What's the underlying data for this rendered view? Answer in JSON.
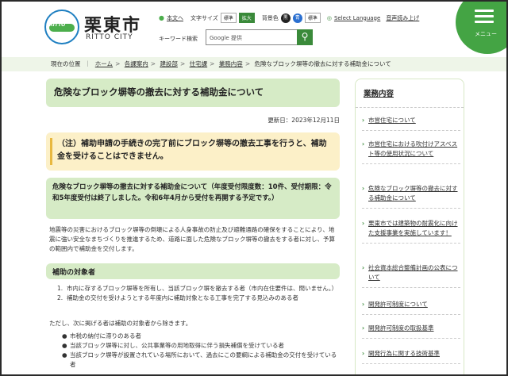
{
  "header": {
    "logo_text": "RITTO",
    "city_name": "栗東市",
    "city_en": "RITTO CITY",
    "about": "本文へ",
    "text_size_label": "文字サイズ",
    "size_standard": "標準",
    "size_large": "拡大",
    "bg_color_label": "背景色",
    "bg_black": "黒",
    "bg_blue": "青",
    "bg_standard": "標準",
    "language": "Select Language",
    "read_aloud": "音声読み上げ",
    "search_label": "キーワード検索",
    "search_placeholder": "Google 提供",
    "menu_label": "メニュー"
  },
  "breadcrumb": {
    "current_label": "現在の位置",
    "items": [
      "ホーム",
      "各課案内",
      "建設部",
      "住宅課",
      "業務内容"
    ],
    "current": "危険なブロック塀等の撤去に対する補助金について"
  },
  "main": {
    "title": "危険なブロック塀等の撤去に対する補助金について",
    "updated": "更新日：2023年12月11日",
    "notice": "（注）補助申請の手続きの完了前にブロック塀等の撤去工事を行うと、補助金を受けることはできません。",
    "subheading": "危険なブロック塀等の撤去に対する補助金について（年度受付限度数：10件、受付期限：令和5年度受付は終了しました。令和6年4月から受付を再開する予定です。）",
    "paragraph": "地震等の災害におけるブロック塀等の倒壊による人身事故の防止及び避難通路の確保をすることにより、地震に強い安全なまちづくりを推進するため、道路に面した危険なブロック塀等の撤去をする者に対し、予算の範囲内で補助金を交付します。",
    "target_heading": "補助の対象者",
    "targets": [
      {
        "num": "1.",
        "text": "市内に存するブロック塀等を所有し、当該ブロック塀を撤去する者（市内在住要件は、問いません。）"
      },
      {
        "num": "2.",
        "text": "補助金の交付を受けようとする年度内に補助対象となる工事を完了する見込みのある者"
      }
    ],
    "except_text": "ただし、次に掲げる者は補助の対象者から除きます。",
    "exclusions": [
      "市税の納付に滞りのある者",
      "当該ブロック塀等に対し、公共事業等の用地取得に伴う損失補償を受けている者",
      "当該ブロック塀等が設置されている場所において、過去にこの要綱による補助金の交付を受けている者"
    ]
  },
  "sidebar": {
    "heading": "業務内容",
    "items": [
      "市営住宅について",
      "市営住宅における吹付けアスベスト等の使用状況について",
      "危険なブロック塀等の撤去に対する補助金について",
      "栗東市では建築物の耐震化に向けた支援事業を実施しています！",
      "社会資本総合整備計画の公表について",
      "開発許可制度について",
      "開発許可制度の取扱基準",
      "開発行為に関する技術基準"
    ]
  },
  "colors": {
    "green_accent": "#3a8a3a",
    "light_green": "#d6ebc6",
    "notice_yellow": "#fcf0c8",
    "menu_green": "#44a444"
  }
}
